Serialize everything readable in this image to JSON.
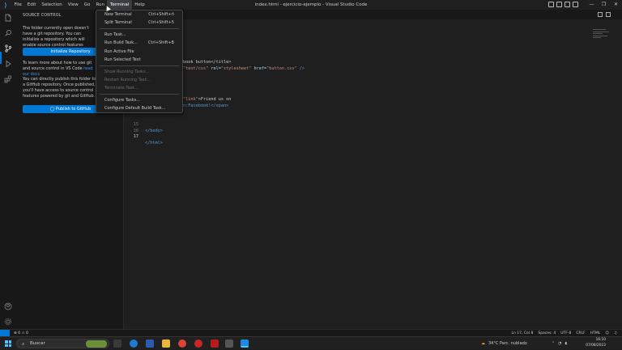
{
  "window": {
    "title": "index.html - ejercicio-ejemplo - Visual Studio Code",
    "controls": [
      "—",
      "❐",
      "✕"
    ]
  },
  "menubar": {
    "items": [
      "File",
      "Edit",
      "Selection",
      "View",
      "Go",
      "Run",
      "Terminal",
      "Help"
    ],
    "active": "Terminal"
  },
  "sidebar": {
    "header": "SOURCE CONTROL",
    "para1": "The folder currently open doesn't have a git repository. You can initialize a repository which will enable source control features powered by git.",
    "init_button": "Initialize Repository",
    "para2_pre": "To learn more about how to use git and source control in VS Code ",
    "para2_link": "read our docs",
    "para3": "You can directly publish this folder to a GitHub repository. Once published, you'll have access to source control features powered by git and GitHub.",
    "publish_button": "Publish to GitHub"
  },
  "terminal_menu": {
    "items": [
      {
        "label": "New Terminal",
        "shortcut": "Ctrl+Shift+ñ",
        "enabled": true
      },
      {
        "label": "Split Terminal",
        "shortcut": "Ctrl+Shift+5",
        "enabled": true
      },
      {
        "label": "Run Task...",
        "shortcut": "",
        "enabled": true
      },
      {
        "label": "Run Build Task...",
        "shortcut": "Ctrl+Shift+B",
        "enabled": true
      },
      {
        "label": "Run Active File",
        "shortcut": "",
        "enabled": true
      },
      {
        "label": "Run Selected Text",
        "shortcut": "",
        "enabled": true
      },
      {
        "label": "Show Running Tasks...",
        "shortcut": "",
        "enabled": false
      },
      {
        "label": "Restart Running Task...",
        "shortcut": "",
        "enabled": false
      },
      {
        "label": "Terminate Task...",
        "shortcut": "",
        "enabled": false
      },
      {
        "label": "Configure Tasks...",
        "shortcut": "",
        "enabled": true
      },
      {
        "label": "Configure Default Build Task...",
        "shortcut": "",
        "enabled": true
      }
    ]
  },
  "editor": {
    "visible_fragments": {
      "title_tail": "book button</title>",
      "link_tail_type": "\"text/css\"",
      "link_tail_rel": "rel=",
      "link_tail_rel_val": "\"stylesheet\"",
      "link_tail_href": "href=",
      "link_tail_href_val": "\"button.css\"",
      "link_tail_end": " />",
      "a_class_val": "\"link\"",
      "a_text": ">Friend us on",
      "span_text": "n:Facebook!</span>"
    },
    "lines": [
      {
        "num": "15",
        "content": "</body>"
      },
      {
        "num": "16",
        "content": ""
      },
      {
        "num": "17",
        "content": "</html>"
      }
    ]
  },
  "statusbar": {
    "problems": "⊗ 0 ⚠ 0",
    "position": "Ln 17, Col 8",
    "spaces": "Spaces: 4",
    "encoding": "UTF-8",
    "eol": "CRLF",
    "language": "HTML"
  },
  "taskbar": {
    "search_label": "Buscar",
    "weather": "34°C  Parc. nublado",
    "time": "16:10",
    "date": "07/08/2023"
  }
}
